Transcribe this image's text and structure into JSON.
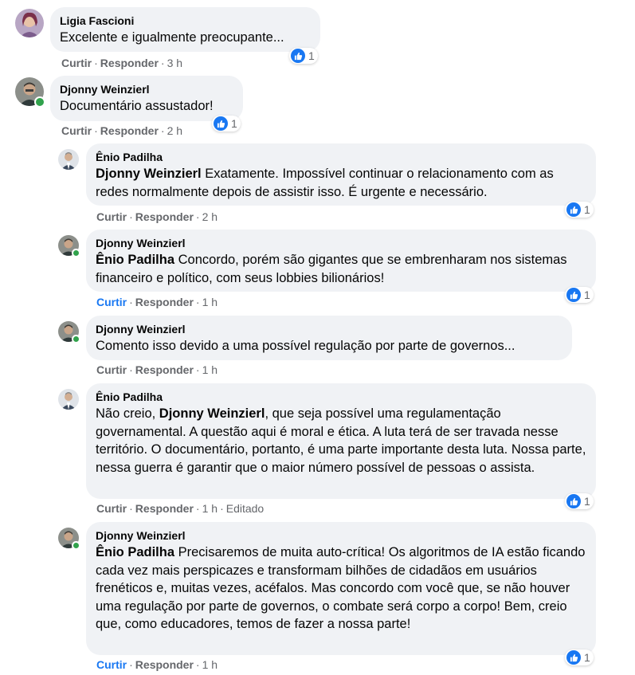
{
  "labels": {
    "like": "Curtir",
    "reply": "Responder",
    "dot": "·"
  },
  "colors": {
    "accent": "#1877f2",
    "bubble": "#f0f2f5",
    "meta": "#65676b",
    "online": "#31a24c"
  },
  "comments": [
    {
      "author": "Ligia Fascioni",
      "mention": "",
      "text": "Excelente e igualmente preocupante...",
      "time": "3 h",
      "edited": "",
      "likes": "1",
      "liked": false
    },
    {
      "author": "Djonny Weinzierl",
      "mention": "",
      "text": "Documentário assustador!",
      "time": "2 h",
      "edited": "",
      "likes": "1",
      "liked": false
    },
    {
      "author": "Ênio Padilha",
      "mention": "Djonny Weinzierl",
      "text": "Exatamente. Impossível continuar o relacionamento com as redes normalmente depois de assistir isso. É urgente e necessário.",
      "time": "2 h",
      "edited": "",
      "likes": "1",
      "liked": false
    },
    {
      "author": "Djonny Weinzierl",
      "mention": "Ênio Padilha",
      "text": "Concordo, porém são gigantes que se embrenharam nos sistemas financeiro e político, com seus lobbies bilionários!",
      "time": "1 h",
      "edited": "",
      "likes": "1",
      "liked": true
    },
    {
      "author": "Djonny Weinzierl",
      "mention": "",
      "text": "Comento isso devido a uma possível regulação por parte de governos...",
      "time": "1 h",
      "edited": "",
      "likes": "",
      "liked": false
    },
    {
      "author": "Ênio Padilha",
      "text_before": "Não creio, ",
      "mention": "Djonny Weinzierl",
      "text": ", que seja possível uma regulamentação governamental. A questão aqui é moral e ética. A luta terá de ser travada nesse território. O documentário, portanto, é uma parte importante desta luta. Nossa parte, nessa guerra é garantir que o maior número possível de pessoas o assista.",
      "time": "1 h",
      "edited": "Editado",
      "likes": "1",
      "liked": false
    },
    {
      "author": "Djonny Weinzierl",
      "mention": "Ênio Padilha",
      "text": "Precisaremos de muita auto-crítica! Os algoritmos de IA estão ficando cada vez mais perspicazes e transformam bilhões de cidadãos em usuários frenéticos e, muitas vezes, acéfalos. Mas concordo com você que, se não houver uma regulação por parte de governos, o combate será corpo a corpo! Bem, creio que, como educadores, temos de fazer a nossa parte!",
      "time": "1 h",
      "edited": "",
      "likes": "1",
      "liked": true
    }
  ]
}
